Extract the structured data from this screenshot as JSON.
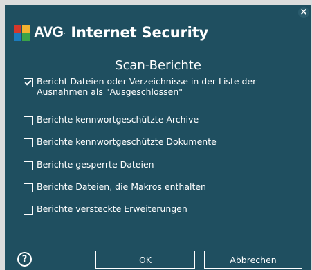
{
  "window": {
    "close_glyph": "×"
  },
  "brand": {
    "name": "AVG",
    "product": "Internet Security",
    "tm": "."
  },
  "title": "Scan-Berichte",
  "options": [
    {
      "label_line1": "Bericht Dateien oder Verzeichnisse in der Liste der",
      "label_line2": "Ausnahmen als \"Ausgeschlossen\"",
      "checked": true
    },
    {
      "label": "Berichte kennwortgeschützte Archive",
      "checked": false
    },
    {
      "label": "Berichte kennwortgeschützte Dokumente",
      "checked": false
    },
    {
      "label": "Berichte gesperrte Dateien",
      "checked": false
    },
    {
      "label": "Berichte Dateien, die Makros enthalten",
      "checked": false
    },
    {
      "label": "Berichte versteckte Erweiterungen",
      "checked": false
    }
  ],
  "footer": {
    "help_glyph": "?",
    "ok_label": "OK",
    "cancel_label": "Abbrechen"
  },
  "colors": {
    "background": "#1f4f60",
    "text": "#ffffff"
  }
}
